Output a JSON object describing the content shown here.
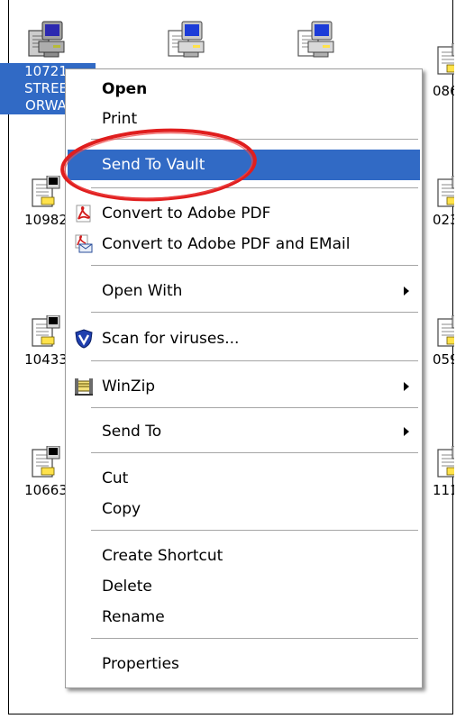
{
  "desktop": {
    "files": [
      {
        "label_lines": [
          "10721",
          "STREE",
          "ORWA"
        ]
      },
      {
        "label_lines": [
          "086"
        ]
      },
      {
        "label_lines": [
          "10982"
        ]
      },
      {
        "label_lines": [
          "023"
        ]
      },
      {
        "label_lines": [
          "10433"
        ]
      },
      {
        "label_lines": [
          "059"
        ]
      },
      {
        "label_lines": [
          "10663"
        ]
      },
      {
        "label_lines": [
          "111"
        ]
      }
    ]
  },
  "context_menu": {
    "items": {
      "open": "Open",
      "print": "Print",
      "send_to_vault": "Send To Vault",
      "convert_pdf": "Convert to Adobe PDF",
      "convert_pdf_email": "Convert to Adobe PDF and EMail",
      "open_with": "Open With",
      "scan_viruses": "Scan for viruses...",
      "winzip": "WinZip",
      "send_to": "Send To",
      "cut": "Cut",
      "copy": "Copy",
      "create_shortcut": "Create Shortcut",
      "delete": "Delete",
      "rename": "Rename",
      "properties": "Properties"
    }
  },
  "colors": {
    "selection": "#316ac5",
    "annotation_ring": "#e01e1e",
    "menu_border": "#9d9d9d"
  },
  "icons": {
    "file_icon": "computer-document-icon",
    "pdf_icon": "adobe-pdf-icon",
    "pdf_email_icon": "adobe-pdf-email-icon",
    "antivirus_icon": "shield-v-icon",
    "winzip_icon": "winzip-vise-icon",
    "submenu_arrow": "arrow-right-icon"
  }
}
